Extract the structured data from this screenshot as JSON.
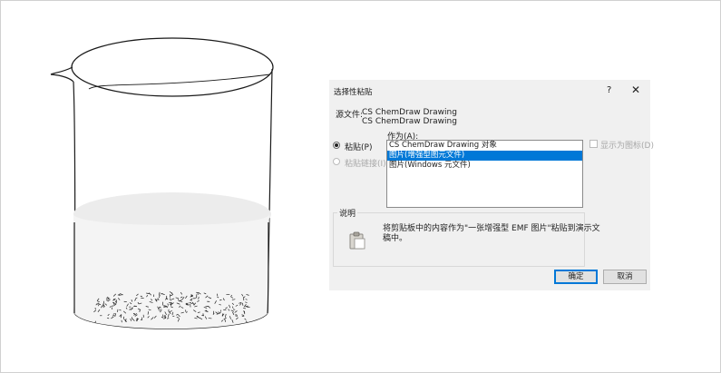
{
  "dialog": {
    "title": "选择性粘贴",
    "help": "?",
    "close": "✕",
    "source_label": "源文件:",
    "source_line1": "CS ChemDraw Drawing",
    "source_line2": "CS ChemDraw Drawing",
    "as_label": "作为(A):",
    "options": {
      "paste": "粘贴(P)",
      "paste_link": "粘贴链接(I)",
      "display_as_icon": "显示为图标(D)"
    },
    "list_items": [
      "CS ChemDraw Drawing 对象",
      "图片(增强型图元文件)",
      "图片(Windows 元文件)"
    ],
    "selected_index": 1,
    "result_group_label": "说明",
    "result_line1": "将剪贴板中的内容作为\"一张增强型 EMF 图片\"粘贴到演示文",
    "result_line2": "稿中。",
    "ok_label": "确定",
    "cancel_label": "取消"
  },
  "icons": {
    "beaker": "beaker-illustration",
    "clipboard": "clipboard-icon"
  }
}
